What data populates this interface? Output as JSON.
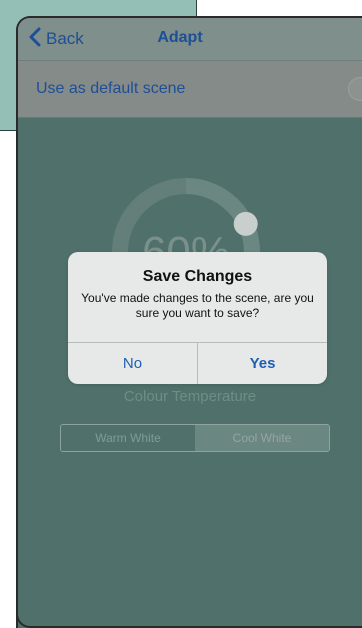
{
  "nav": {
    "back_label": "Back",
    "title": "Adapt"
  },
  "default_scene": {
    "label": "Use as default scene",
    "checked": false
  },
  "dial": {
    "text": "60%",
    "fraction": 0.6
  },
  "colour_temperature": {
    "label": "Colour Temperature",
    "options": [
      "Warm White",
      "Cool White"
    ],
    "selected": "Cool White"
  },
  "dialog": {
    "title": "Save Changes",
    "message": "You've made changes to the scene, are you sure you want to save?",
    "no_label": "No",
    "yes_label": "Yes"
  },
  "colors": {
    "accent": "#1d4f96",
    "background": "#50716b",
    "frame": "#93bfb6"
  }
}
